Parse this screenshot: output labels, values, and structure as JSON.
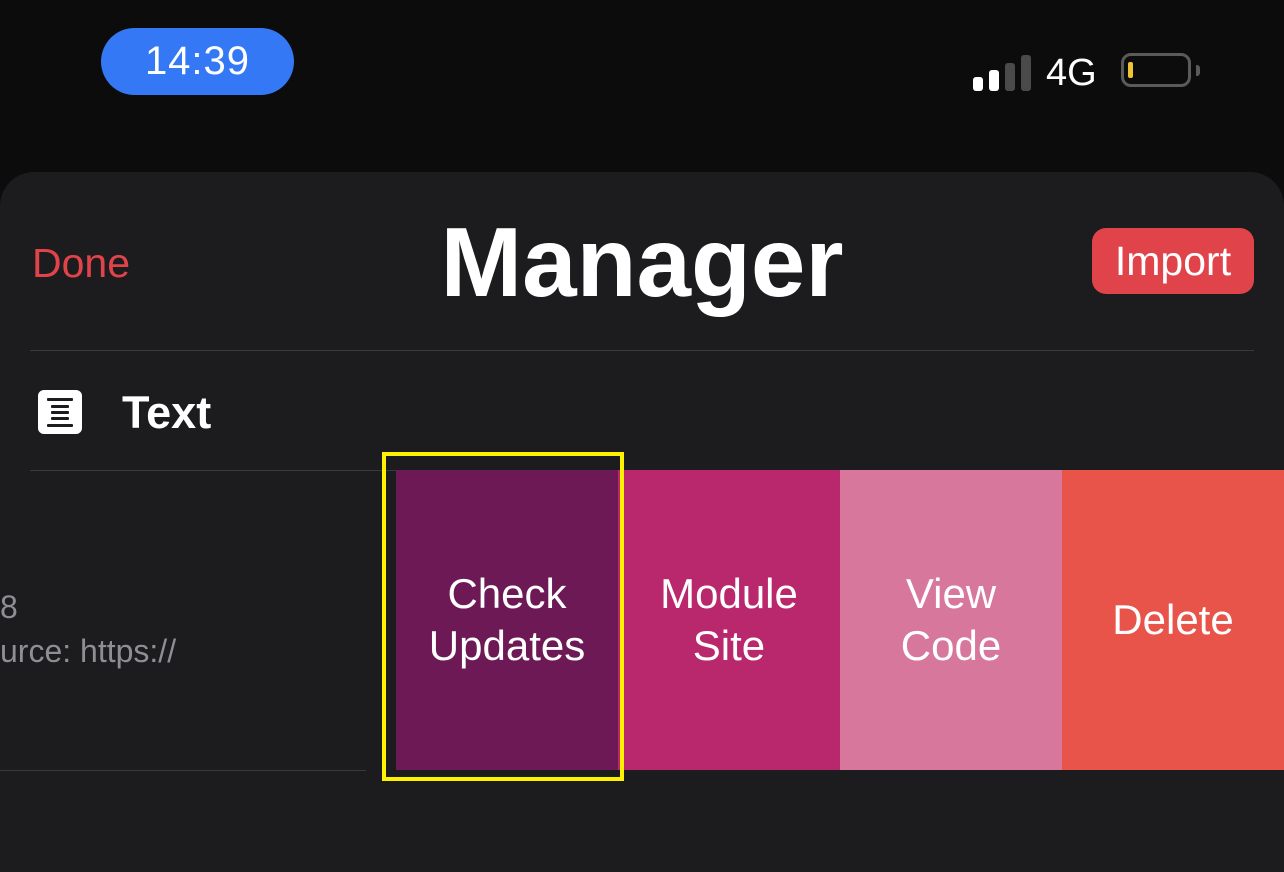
{
  "status_bar": {
    "time": "14:39",
    "network": "4G",
    "time_pill_color": "#3478f6",
    "signal_bars_active": 2,
    "signal_bars_total": 4,
    "battery_level_color": "#f1c232"
  },
  "header": {
    "done_label": "Done",
    "title": "Manager",
    "import_label": "Import",
    "accent_color": "#e0444a"
  },
  "list": {
    "section_label": "Text",
    "section_icon": "text-align-icon",
    "row": {
      "version_fragment": "8",
      "source_fragment": "urce: https://"
    }
  },
  "swipe_actions": [
    {
      "line1": "Check",
      "line2": "Updates",
      "color": "#6d1956"
    },
    {
      "line1": "Module",
      "line2": "Site",
      "color": "#b9286c"
    },
    {
      "line1": "View",
      "line2": "Code",
      "color": "#d7779c"
    },
    {
      "line1": "Delete",
      "line2": "",
      "color": "#e9544a"
    }
  ],
  "highlight_color": "#fff200"
}
